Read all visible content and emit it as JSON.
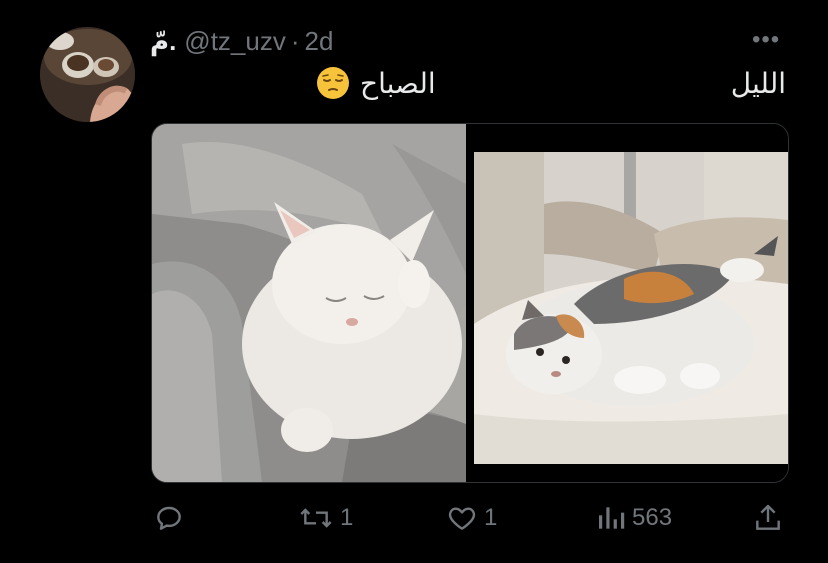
{
  "tweet": {
    "display_name": "مّ.",
    "handle": "@tz_uzv",
    "separator": "·",
    "time": "2d",
    "more_label": "•••",
    "text_right": "الليل",
    "text_left": "الصباح",
    "emoji_icon": "pensive-face-icon"
  },
  "media": {
    "left_image": "white-cat-sleeping-on-blanket",
    "right_image": "calico-cat-lying-on-cushion"
  },
  "actions": {
    "reply_icon": "reply-icon",
    "retweet_count": "1",
    "like_count": "1",
    "views_count": "563",
    "share_icon": "share-icon"
  },
  "colors": {
    "background": "#000000",
    "text_primary": "#e7e9ea",
    "text_secondary": "#71767b",
    "border": "#2f3336"
  }
}
